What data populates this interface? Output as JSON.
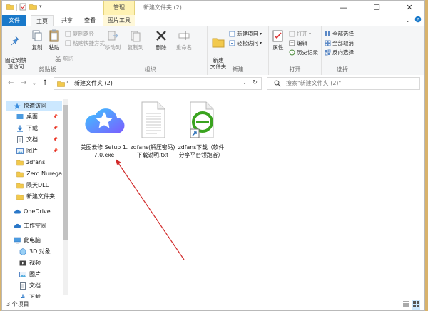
{
  "window": {
    "title": "新建文件夹 (2)",
    "context_tab": "管理",
    "controls": {
      "minimize": "—",
      "maximize": "☐",
      "close": "✕"
    }
  },
  "tabs": [
    {
      "label": "文件"
    },
    {
      "label": "主页"
    },
    {
      "label": "共享"
    },
    {
      "label": "查看"
    },
    {
      "label": "图片工具"
    }
  ],
  "ribbon": {
    "clipboard": {
      "label": "剪贴板",
      "pin": "固定到快\n速访问",
      "copy": "复制",
      "paste": "粘贴",
      "copy_path": "复制路径",
      "paste_shortcut": "粘贴快捷方式",
      "cut": "剪切"
    },
    "organize": {
      "label": "组织",
      "move_to": "移动到",
      "copy_to": "复制到",
      "delete": "删除",
      "rename": "重命名"
    },
    "new": {
      "label": "新建",
      "new_folder": "新建\n文件夹",
      "new_item": "新建项目",
      "easy_access": "轻松访问"
    },
    "open": {
      "label": "打开",
      "properties": "属性",
      "open": "打开",
      "edit": "编辑",
      "history": "历史记录"
    },
    "select": {
      "label": "选择",
      "select_all": "全部选择",
      "select_none": "全部取消",
      "invert": "反向选择"
    }
  },
  "address": {
    "path": "新建文件夹 (2)",
    "search_placeholder": "搜索\"新建文件夹 (2)\""
  },
  "nav": {
    "items": [
      {
        "label": "快速访问"
      },
      {
        "label": "桌面"
      },
      {
        "label": "下载"
      },
      {
        "label": "文档"
      },
      {
        "label": "图片"
      },
      {
        "label": "zdfans"
      },
      {
        "label": "Zero Nurega"
      },
      {
        "label": "陨天DLL"
      },
      {
        "label": "新建文件夹"
      },
      {
        "label": "OneDrive"
      },
      {
        "label": "工作空间"
      },
      {
        "label": "此电脑"
      },
      {
        "label": "3D 对象"
      },
      {
        "label": "视频"
      },
      {
        "label": "图片"
      },
      {
        "label": "文档"
      },
      {
        "label": "下载"
      }
    ]
  },
  "files": [
    {
      "name": "美图云修 Setup 1.7.0.exe",
      "icon": "cloud-star-icon"
    },
    {
      "name": "zdfans(解压密码)下载说明.txt",
      "icon": "text-file-icon"
    },
    {
      "name": "zdfans下载（软件分享平台领跑者）",
      "icon": "ie-shortcut-icon"
    }
  ],
  "status": {
    "count": "3 个项目"
  },
  "colors": {
    "accent": "#1979ca",
    "selection": "#cce8ff",
    "annotation": "#d12a2a"
  }
}
